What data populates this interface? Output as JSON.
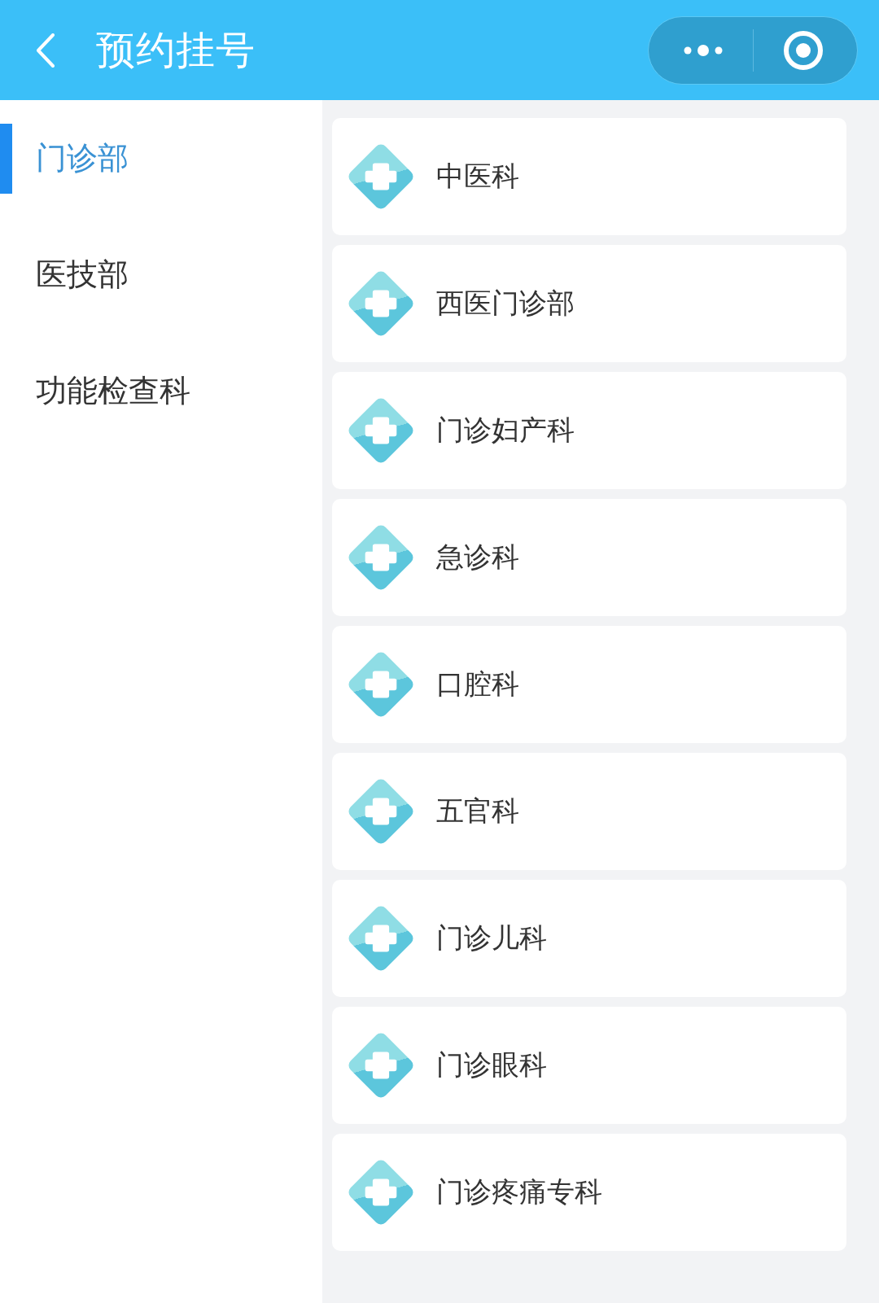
{
  "header": {
    "title": "预约挂号"
  },
  "sidebar": {
    "items": [
      {
        "label": "门诊部",
        "selected": true
      },
      {
        "label": "医技部",
        "selected": false
      },
      {
        "label": "功能检查科",
        "selected": false
      }
    ]
  },
  "departments": [
    {
      "name": "中医科"
    },
    {
      "name": "西医门诊部"
    },
    {
      "name": "门诊妇产科"
    },
    {
      "name": "急诊科"
    },
    {
      "name": "口腔科"
    },
    {
      "name": "五官科"
    },
    {
      "name": "门诊儿科"
    },
    {
      "name": "门诊眼科"
    },
    {
      "name": "门诊疼痛专科"
    }
  ]
}
